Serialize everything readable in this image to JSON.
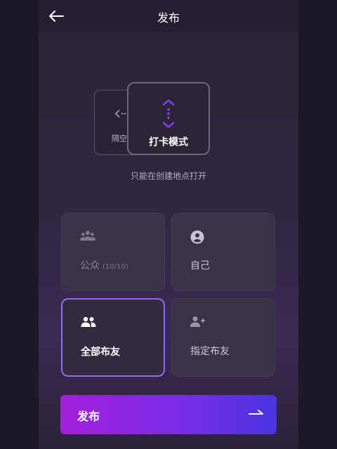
{
  "header": {
    "title": "发布"
  },
  "mode": {
    "back_label": "隔空",
    "front_label": "打卡模式",
    "hint": "只能在创建地点打开"
  },
  "visibility": {
    "public": {
      "label": "公众",
      "count": "(10/10)",
      "icon": "group-icon"
    },
    "self": {
      "label": "自己",
      "icon": "person-circle-icon"
    },
    "friends": {
      "label": "全部布友",
      "icon": "people-icon"
    },
    "specific": {
      "label": "指定布友",
      "icon": "person-add-icon"
    }
  },
  "publish": {
    "label": "发布",
    "icon": "arrow-right-icon"
  },
  "colors": {
    "accent": "#8c6df2",
    "button_start": "#a21fdc",
    "button_end": "#4a34e0",
    "mode_icon": "#7b3ff0"
  }
}
